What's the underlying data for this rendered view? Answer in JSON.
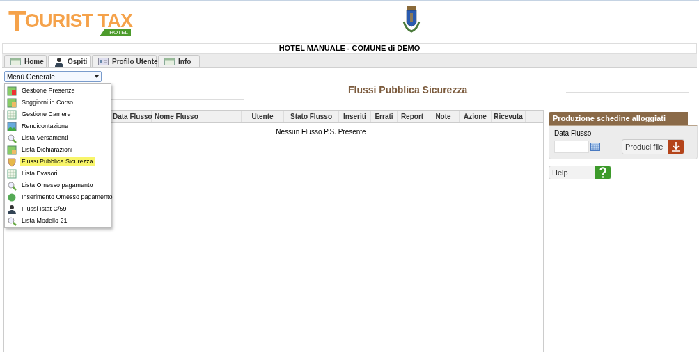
{
  "logo": {
    "text": "OURIST TAX",
    "initial": "T",
    "badge": "HOTEL"
  },
  "header_title": "HOTEL MANUALE - COMUNE di DEMO",
  "tabs": [
    {
      "label": "Home",
      "selected": false
    },
    {
      "label": "Ospiti",
      "selected": true
    },
    {
      "label": "Profilo Utente",
      "selected": false
    },
    {
      "label": "Info",
      "selected": false
    }
  ],
  "menu_select": {
    "value": "Menù Generale",
    "expanded": true
  },
  "menu_items": [
    {
      "label": "Gestione Presenze",
      "selected": false
    },
    {
      "label": "Soggiorni in Corso",
      "selected": false
    },
    {
      "label": "Gestione Camere",
      "selected": false
    },
    {
      "label": "Rendicontazione",
      "selected": false
    },
    {
      "label": "Lista Versamenti",
      "selected": false
    },
    {
      "label": "Lista Dichiarazioni",
      "selected": false
    },
    {
      "label": "Flussi Pubblica Sicurezza",
      "selected": true
    },
    {
      "label": "Lista Evasori",
      "selected": false
    },
    {
      "label": "Lista Omesso pagamento",
      "selected": false
    },
    {
      "label": "Inserimento Omesso pagamento",
      "selected": false
    },
    {
      "label": "Flussi Istat C/59",
      "selected": false
    },
    {
      "label": "Lista Modello 21",
      "selected": false
    }
  ],
  "page_title": "Flussi Pubblica Sicurezza",
  "table": {
    "columns": [
      "Data Flusso",
      "Nome Flusso",
      "Utente",
      "Stato Flusso",
      "Inseriti",
      "Errati",
      "Report",
      "Note",
      "Azione",
      "Ricevuta"
    ],
    "empty_message": "Nessun Flusso P.S. Presente"
  },
  "side_panel": {
    "title": "Produzione schedine alloggiati",
    "field_label": "Data Flusso",
    "button": "Produci file"
  },
  "help_button": "Help"
}
